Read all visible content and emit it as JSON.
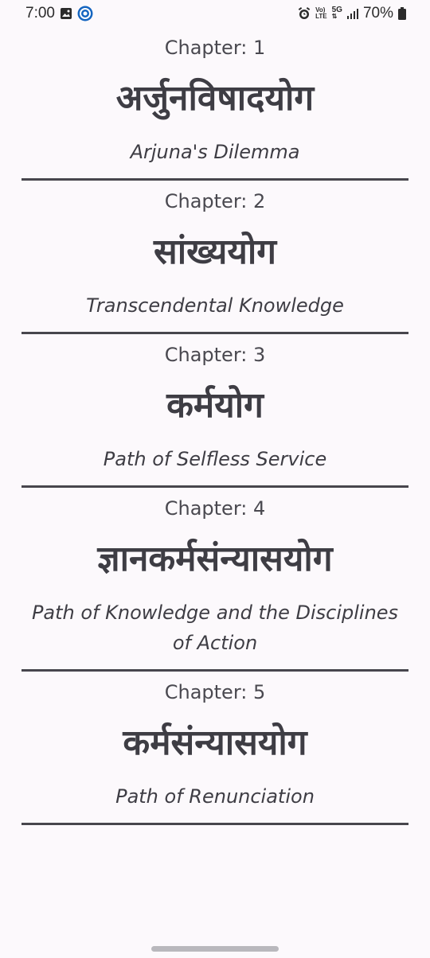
{
  "status_bar": {
    "time": "7:00",
    "network_top": "Vo)",
    "network_bottom": "LTE",
    "network_5g": "5G",
    "battery": "70%"
  },
  "chapters": [
    {
      "number": "Chapter: 1",
      "sanskrit": "अर्जुनविषादयोग",
      "english": "Arjuna's Dilemma"
    },
    {
      "number": "Chapter: 2",
      "sanskrit": "सांख्ययोग",
      "english": "Transcendental Knowledge"
    },
    {
      "number": "Chapter: 3",
      "sanskrit": "कर्मयोग",
      "english": "Path of Selfless Service"
    },
    {
      "number": "Chapter: 4",
      "sanskrit": "ज्ञानकर्मसंन्यासयोग",
      "english": "Path of Knowledge and the Disciplines of Action"
    },
    {
      "number": "Chapter: 5",
      "sanskrit": "कर्मसंन्यासयोग",
      "english": "Path of Renunciation"
    }
  ]
}
